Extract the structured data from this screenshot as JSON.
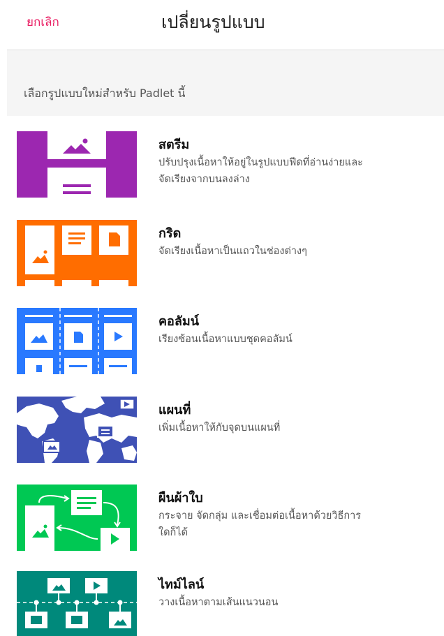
{
  "header": {
    "cancel_label": "ยกเลิก",
    "title": "เปลี่ยนรูปแบบ"
  },
  "subhead": {
    "text": "เลือกรูปแบบใหม่สำหรับ Padlet นี้"
  },
  "options": [
    {
      "title": "สตรีม",
      "desc_line1": "ปรับปรุงเนื้อหาให้อยู่ในรูปแบบฟีดที่อ่านง่ายและ",
      "desc_line2": "จัดเรียงจากบนลงล่าง",
      "icon": "stream-layout-icon",
      "color": "#9c27b0"
    },
    {
      "title": "กริด",
      "desc_line1": "จัดเรียงเนื้อหาเป็นแถวในช่องต่างๆ",
      "desc_line2": "",
      "icon": "grid-layout-icon",
      "color": "#ff6d00"
    },
    {
      "title": "คอลัมน์",
      "desc_line1": "เรียงซ้อนเนื้อหาแบบชุดคอลัมน์",
      "desc_line2": "",
      "icon": "columns-layout-icon",
      "color": "#2979ff"
    },
    {
      "title": "แผนที่",
      "desc_line1": "เพิ่มเนื้อหาให้กับจุดบนแผนที่",
      "desc_line2": "",
      "icon": "map-layout-icon",
      "color": "#3f51b5"
    },
    {
      "title": "ผืนผ้าใบ",
      "desc_line1": "กระจาย จัดกลุ่ม และเชื่อมต่อเนื้อหาด้วยวิธีการ",
      "desc_line2": "ใดก็ได้",
      "icon": "canvas-layout-icon",
      "color": "#00c853"
    },
    {
      "title": "ไทม์ไลน์",
      "desc_line1": "วางเนื้อหาตามเส้นแนวนอน",
      "desc_line2": "",
      "icon": "timeline-layout-icon",
      "color": "#00897b"
    }
  ]
}
